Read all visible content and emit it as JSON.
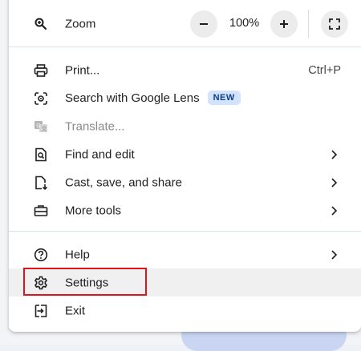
{
  "zoom": {
    "label": "Zoom",
    "value": "100%",
    "decrease_icon": "minus-icon",
    "increase_icon": "plus-icon",
    "fullscreen_icon": "fullscreen-icon"
  },
  "items": {
    "print": {
      "label": "Print...",
      "shortcut": "Ctrl+P",
      "icon": "printer-icon"
    },
    "lens": {
      "label": "Search with Google Lens",
      "badge": "NEW",
      "icon": "google-lens-icon"
    },
    "translate": {
      "label": "Translate...",
      "icon": "translate-icon",
      "disabled": true
    },
    "find": {
      "label": "Find and edit",
      "icon": "find-icon",
      "submenu": true
    },
    "cast": {
      "label": "Cast, save, and share",
      "icon": "cast-save-icon",
      "submenu": true
    },
    "tools": {
      "label": "More tools",
      "icon": "toolbox-icon",
      "submenu": true
    },
    "help": {
      "label": "Help",
      "icon": "help-icon",
      "submenu": true
    },
    "settings": {
      "label": "Settings",
      "icon": "gear-icon",
      "highlighted": true
    },
    "exit": {
      "label": "Exit",
      "icon": "exit-icon"
    }
  },
  "colors": {
    "highlight_box": "#e0141f",
    "badge_bg": "#d3e3fd",
    "badge_text": "#0b3f8a",
    "hover_row": "#f0f0f0"
  }
}
